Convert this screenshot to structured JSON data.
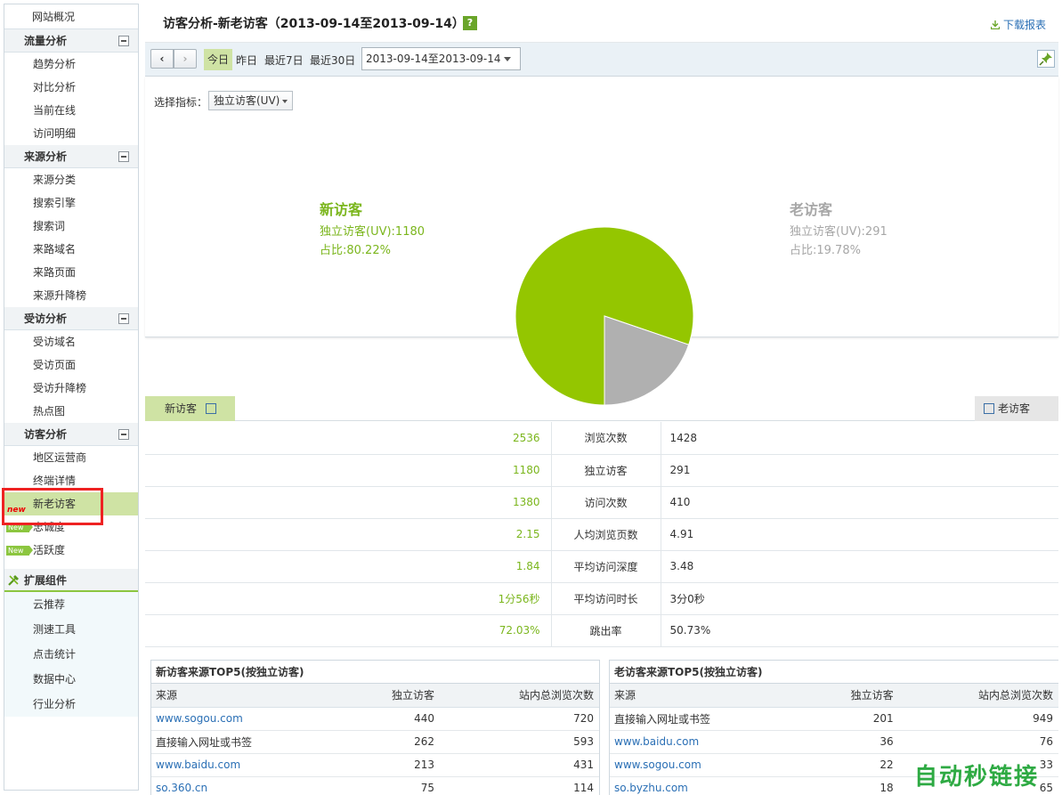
{
  "sidebar": {
    "top_item": "网站概况",
    "groups": [
      {
        "title": "流量分析",
        "items": [
          "趋势分析",
          "对比分析",
          "当前在线",
          "访问明细"
        ]
      },
      {
        "title": "来源分析",
        "items": [
          "来源分类",
          "搜索引擎",
          "搜索词",
          "来路域名",
          "来路页面",
          "来源升降榜"
        ]
      },
      {
        "title": "受访分析",
        "items": [
          "受访域名",
          "受访页面",
          "受访升降榜",
          "热点图"
        ]
      },
      {
        "title": "访客分析",
        "items": [
          "地区运营商",
          "终端详情",
          "新老访客",
          "忠诚度",
          "活跃度"
        ]
      }
    ],
    "new_tag": "new",
    "new_badge": "New",
    "ext_group": {
      "title": "扩展组件",
      "items": [
        "云推荐",
        "测速工具",
        "点击统计",
        "数据中心",
        "行业分析"
      ]
    }
  },
  "header": {
    "title": "访客分析-新老访客（2013-09-14至2013-09-14）",
    "help": "?",
    "download": "下载报表"
  },
  "toolbar": {
    "prev": "‹",
    "next": "›",
    "ranges": [
      "今日",
      "昨日",
      "最近7日",
      "最近30日"
    ],
    "date_value": "2013-09-14至2013-09-14"
  },
  "chart": {
    "metric_label": "选择指标：",
    "metric_value": "独立访客(UV)",
    "new_title": "新访客",
    "new_uv": "独立访客(UV):1180",
    "new_pct": "占比:80.22%",
    "old_title": "老访客",
    "old_uv": "独立访客(UV):291",
    "old_pct": "占比:19.78%"
  },
  "chart_data": {
    "type": "pie",
    "categories": [
      "新访客",
      "老访客"
    ],
    "values": [
      1180,
      291
    ],
    "colors": [
      "#94c600",
      "#b0b0b0"
    ]
  },
  "tabs": {
    "new": "新访客",
    "old": "老访客"
  },
  "comparison": [
    {
      "new": "2536",
      "label": "浏览次数",
      "old": "1428"
    },
    {
      "new": "1180",
      "label": "独立访客",
      "old": "291"
    },
    {
      "new": "1380",
      "label": "访问次数",
      "old": "410"
    },
    {
      "new": "2.15",
      "label": "人均浏览页数",
      "old": "4.91"
    },
    {
      "new": "1.84",
      "label": "平均访问深度",
      "old": "3.48"
    },
    {
      "new": "1分56秒",
      "label": "平均访问时长",
      "old": "3分0秒"
    },
    {
      "new": "72.03%",
      "label": "跳出率",
      "old": "50.73%"
    }
  ],
  "top5_new": {
    "title": "新访客来源TOP5(按独立访客)",
    "headers": [
      "来源",
      "独立访客",
      "站内总浏览次数"
    ],
    "rows": [
      [
        "www.sogou.com",
        "440",
        "720"
      ],
      [
        "直接输入网址或书签",
        "262",
        "593"
      ],
      [
        "www.baidu.com",
        "213",
        "431"
      ],
      [
        "so.360.cn",
        "75",
        "114"
      ]
    ]
  },
  "top5_old": {
    "title": "老访客来源TOP5(按独立访客)",
    "headers": [
      "来源",
      "独立访客",
      "站内总浏览次数"
    ],
    "rows": [
      [
        "直接输入网址或书签",
        "201",
        "949"
      ],
      [
        "www.baidu.com",
        "36",
        "76"
      ],
      [
        "www.sogou.com",
        "22",
        "33"
      ],
      [
        "so.byzhu.com",
        "18",
        "65"
      ]
    ]
  },
  "watermark": "自动秒链接"
}
